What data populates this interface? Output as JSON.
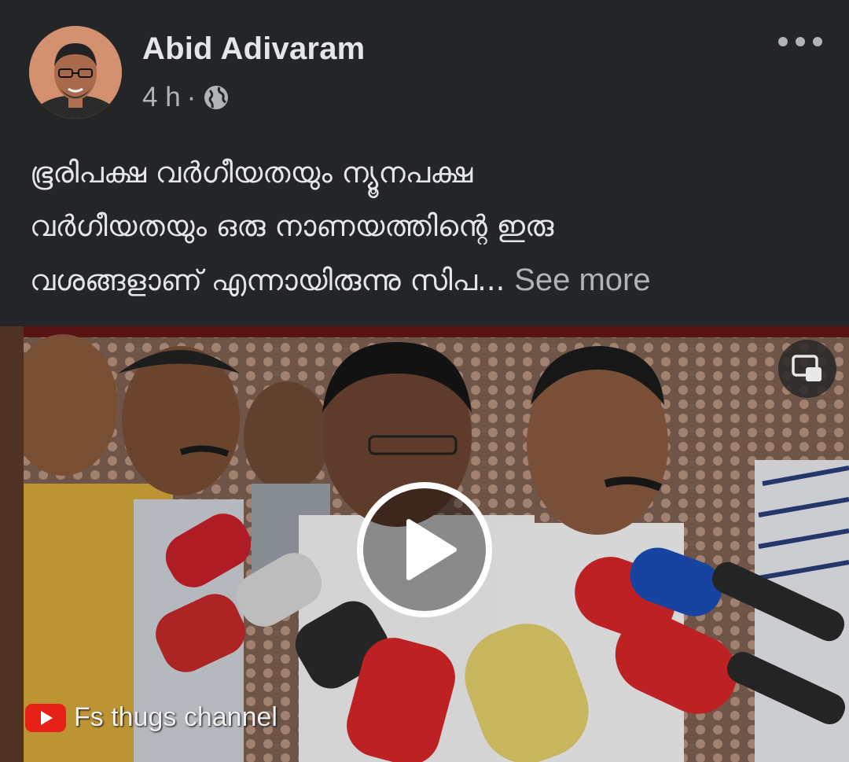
{
  "post": {
    "author": "Abid Adivaram",
    "time": "4 h",
    "separator": "·",
    "privacy_icon": "globe-icon",
    "more_icon": "more-options-icon",
    "caption_lines": [
      "ഭൂരിപക്ഷ വർഗീയതയും ന്യൂനപക്ഷ",
      "വർഗീയതയും ഒരു നാണയത്തിന്റെ ഇരു",
      "വശങ്ങളാണ് എന്നായിരുന്നു സിപ..."
    ],
    "see_more": "See more"
  },
  "video": {
    "watermark": "Fs thugs channel",
    "play_icon": "play-icon",
    "pip_icon": "picture-in-picture-icon"
  },
  "colors": {
    "background": "#242526",
    "text_primary": "#e4e6eb",
    "text_secondary": "#b0b3b8"
  }
}
